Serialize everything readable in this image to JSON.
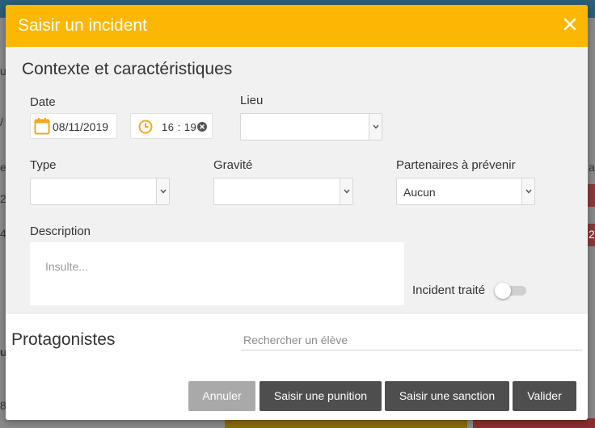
{
  "modal": {
    "title": "Saisir un incident"
  },
  "context": {
    "title": "Contexte et caractéristiques",
    "date_label": "Date",
    "date_value": "08/11/2019",
    "time_value": "16 : 19",
    "lieu_label": "Lieu",
    "lieu_value": "",
    "type_label": "Type",
    "type_value": "",
    "gravite_label": "Gravité",
    "gravite_value": "",
    "partenaires_label": "Partenaires à prévenir",
    "partenaires_value": "Aucun",
    "description_label": "Description",
    "description_placeholder": "Insulte...",
    "incident_traite_label": "Incident traité",
    "incident_traite_on": false
  },
  "protagonists": {
    "title": "Protagonistes",
    "search_placeholder": "Rechercher un élève"
  },
  "footer": {
    "cancel_label": "Annuler",
    "punition_label": "Saisir une punition",
    "sanction_label": "Saisir une sanction",
    "valider_label": "Valider"
  },
  "colors": {
    "header": "#fbb704",
    "dark_button": "#4e4e4e",
    "cancel_button": "#a9a9a9",
    "section_bg": "#f1f1f1"
  },
  "background": {
    "edge_chars": [
      "u",
      "/",
      "e",
      "2",
      "4",
      "a",
      "2",
      "8",
      "u"
    ]
  }
}
